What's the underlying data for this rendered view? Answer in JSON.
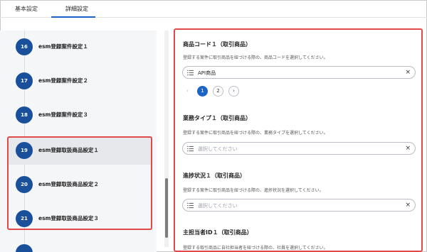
{
  "tabs": [
    {
      "label": "基本設定",
      "active": false
    },
    {
      "label": "詳細設定",
      "active": true
    }
  ],
  "steps": [
    {
      "num": "16",
      "label": "esm登録案件設定１"
    },
    {
      "num": "17",
      "label": "esm登録案件設定２"
    },
    {
      "num": "18",
      "label": "esm登録案件設定３"
    },
    {
      "num": "19",
      "label": "esm登録取扱商品設定１",
      "selected": true
    },
    {
      "num": "20",
      "label": "esm登録取扱商品設定２"
    },
    {
      "num": "21",
      "label": "esm登録取扱商品設定３"
    }
  ],
  "sections": [
    {
      "title": "商品コード１（取引商品）",
      "description": "登録する案件に取引商品を紐づける際の、商品コードを選択してください。",
      "value": "API商品",
      "placeholder": ""
    },
    {
      "title": "業務タイプ１（取引商品）",
      "description": "登録する案件に取引商品を紐づける際の、業務タイプを選択してください。",
      "value": "",
      "placeholder": "選択してください"
    },
    {
      "title": "進捗状況１（取引商品）",
      "description": "登録する案件に取引商品を紐づける際の、進捗状況を選択してください。",
      "value": "",
      "placeholder": "選択してください"
    },
    {
      "title": "主担当者ID１（取引商品）",
      "description": "登録する取引商品に自社担当者を紐づける際の、社員を選択してください。"
    }
  ],
  "pagination": {
    "prev": "‹",
    "pages": [
      "1",
      "2"
    ],
    "current": "1",
    "next": "›"
  },
  "icons": {
    "clear": "×",
    "list": "list-icon"
  },
  "colors": {
    "accent": "#1b64c8",
    "step_badge": "#1a4f9c",
    "highlight": "#e04a4a"
  }
}
